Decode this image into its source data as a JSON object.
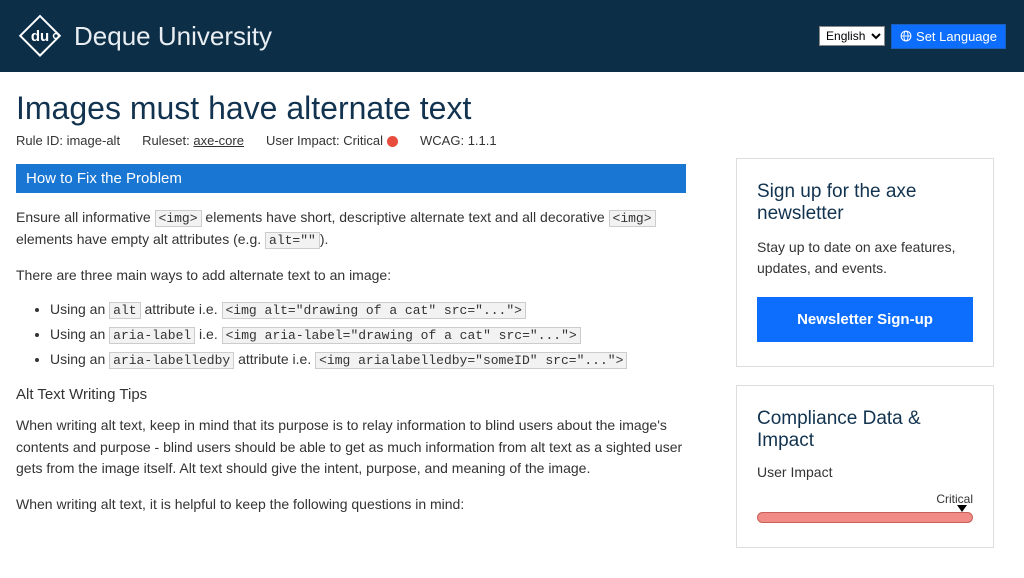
{
  "header": {
    "brand": "Deque University",
    "language_selected": "English",
    "set_language": "Set Language"
  },
  "title": "Images must have alternate text",
  "meta": {
    "rule_id_label": "Rule ID:",
    "rule_id": "image-alt",
    "ruleset_label": "Ruleset:",
    "ruleset": "axe-core",
    "user_impact_label": "User Impact:",
    "user_impact": "Critical",
    "wcag_label": "WCAG:",
    "wcag": "1.1.1"
  },
  "section_header": "How to Fix the Problem",
  "intro": {
    "p1_a": "Ensure all informative ",
    "code1": "<img>",
    "p1_b": " elements have short, descriptive alternate text and all decorative ",
    "code2": "<img>",
    "p1_c": " elements have empty alt attributes (e.g. ",
    "code3": "alt=\"\"",
    "p1_d": ").",
    "p2": "There are three main ways to add alternate text to an image:"
  },
  "ways": [
    {
      "pre": "Using an ",
      "attr": "alt",
      "mid": " attribute i.e. ",
      "example": "<img alt=\"drawing of a cat\" src=\"...\">"
    },
    {
      "pre": "Using an ",
      "attr": "aria-label",
      "mid": " i.e. ",
      "example": "<img aria-label=\"drawing of a cat\" src=\"...\">"
    },
    {
      "pre": "Using an ",
      "attr": "aria-labelledby",
      "mid": " attribute i.e. ",
      "example": "<img arialabelledby=\"someID\" src=\"...\">"
    }
  ],
  "tips": {
    "heading": "Alt Text Writing Tips",
    "p1": "When writing alt text, keep in mind that its purpose is to relay information to blind users about the image's contents and purpose - blind users should be able to get as much information from alt text as a sighted user gets from the image itself. Alt text should give the intent, purpose, and meaning of the image.",
    "p2": "When writing alt text, it is helpful to keep the following questions in mind:"
  },
  "newsletter": {
    "heading": "Sign up for the axe newsletter",
    "body": "Stay up to date on axe features, updates, and events.",
    "button": "Newsletter Sign-up"
  },
  "compliance": {
    "heading": "Compliance Data & Impact",
    "label": "User Impact",
    "tick": "Critical"
  }
}
